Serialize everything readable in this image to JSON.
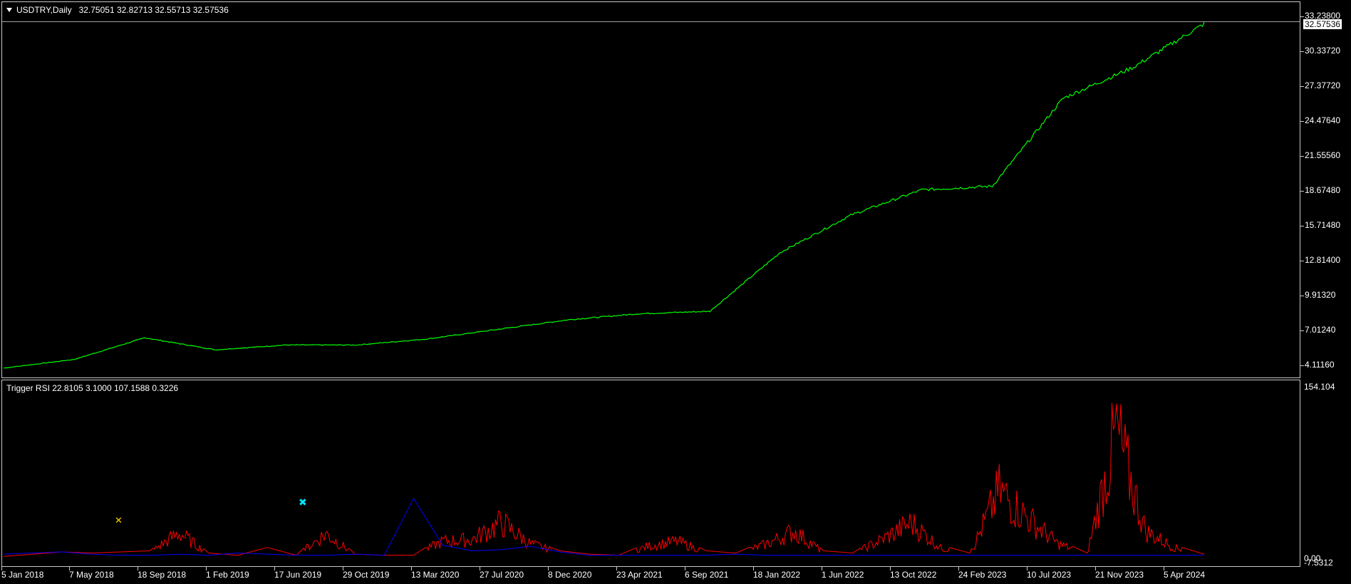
{
  "chart_window": {
    "symbol_info": "USDTRY,Daily",
    "ohlc": "32.75051 32.82713 32.55713 32.57536",
    "current_price": "32.57536"
  },
  "indicator": {
    "info": "Trigger RSI 22.8105 3.1000 107.1588 0.3226",
    "y_top": "154.104",
    "y_zero": "0.00",
    "y_bottom": "-7.5312"
  },
  "colors": {
    "price_line": "#00ff00",
    "rsi_red": "#ff0000",
    "rsi_blue": "#0000ff",
    "marker_yellow": "#ffd700",
    "marker_cyan": "#00e5ff",
    "grid_border": "#c8c8c8",
    "background": "#000000"
  },
  "price_axis_labels": [
    "33.23800",
    "30.33720",
    "27.37720",
    "24.47640",
    "21.55560",
    "18.67480",
    "15.71480",
    "12.81400",
    "9.91320",
    "7.01240",
    "4.11160"
  ],
  "time_axis_labels": [
    "5 Jan 2018",
    "7 May 2018",
    "18 Sep 2018",
    "1 Feb 2019",
    "17 Jun 2019",
    "29 Oct 2019",
    "13 Mar 2020",
    "27 Jul 2020",
    "8 Dec 2020",
    "23 Apr 2021",
    "6 Sep 2021",
    "18 Jan 2022",
    "1 Jun 2022",
    "13 Oct 2022",
    "24 Feb 2023",
    "10 Jul 2023",
    "21 Nov 2023",
    "5 Apr 2024"
  ],
  "chart_data": [
    {
      "type": "line",
      "series": [
        {
          "x": [
            "5 Jan 2018",
            "7 May 2018",
            "18 Sep 2018",
            "1 Feb 2019",
            "17 Jun 2019",
            "29 Oct 2019",
            "13 Mar 2020",
            "27 Jul 2020",
            "8 Dec 2020",
            "23 Apr 2021",
            "6 Sep 2021",
            "18 Jan 2022",
            "1 Jun 2022",
            "13 Oct 2022",
            "24 Feb 2023",
            "10 Jul 2023",
            "21 Nov 2023",
            "5 Apr 2024"
          ],
          "values": [
            3.78,
            4.5,
            6.3,
            5.3,
            5.7,
            5.7,
            6.2,
            7.0,
            7.8,
            8.3,
            8.5,
            13.4,
            16.5,
            18.6,
            18.9,
            26.2,
            28.8,
            32.4
          ]
        }
      ],
      "ylim": [
        3.0,
        34.2
      ]
    },
    {
      "type": "line",
      "series": [
        {
          "values": [
            0,
            2,
            4,
            3,
            4,
            5,
            28,
            3,
            1,
            8,
            1,
            27,
            2,
            1,
            1,
            18,
            20,
            40,
            15,
            5,
            2,
            1,
            12,
            18,
            5,
            3,
            14,
            30,
            5,
            3,
            20,
            40,
            10,
            3,
            78,
            45,
            15,
            3,
            148,
            30,
            10,
            2
          ]
        },
        {
          "values": [
            2,
            3,
            4,
            2,
            1,
            1,
            2,
            1,
            3,
            2,
            1,
            1,
            2,
            1,
            52,
            10,
            5,
            6,
            9,
            4,
            1,
            1,
            1,
            1,
            1,
            2,
            1,
            1,
            1,
            1,
            1,
            1,
            1,
            1,
            1,
            1,
            1,
            1,
            1,
            1,
            1,
            1
          ]
        }
      ],
      "ylim": [
        -7.5312,
        154.104
      ]
    }
  ]
}
